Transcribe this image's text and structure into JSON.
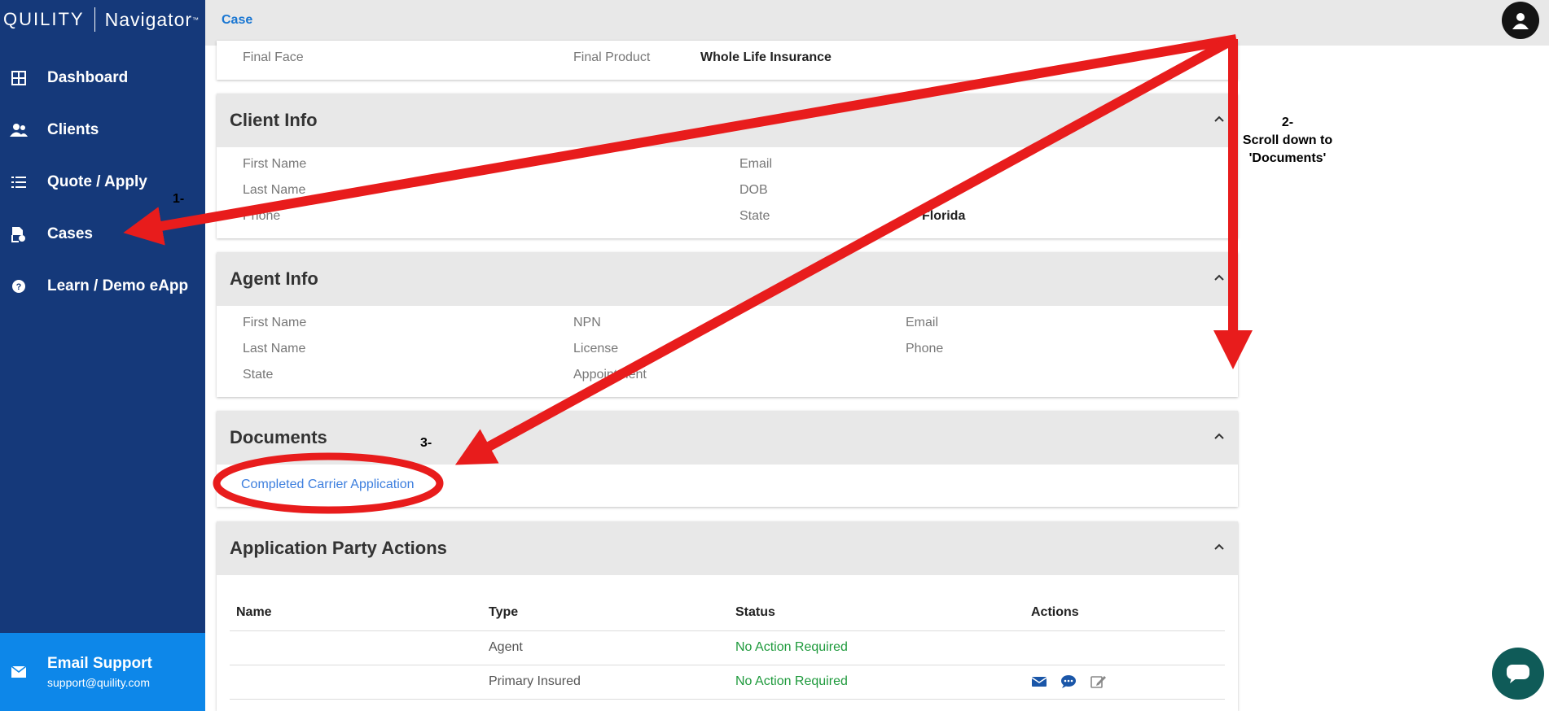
{
  "brand": {
    "name": "QUILITY",
    "product": "Navigator",
    "tm": "™"
  },
  "sidebar": {
    "items": [
      {
        "label": "Dashboard",
        "icon": "dashboard-icon"
      },
      {
        "label": "Clients",
        "icon": "clients-icon"
      },
      {
        "label": "Quote / Apply",
        "icon": "list-icon"
      },
      {
        "label": "Cases",
        "icon": "cases-icon"
      },
      {
        "label": "Learn / Demo eApp",
        "icon": "help-icon"
      }
    ],
    "support": {
      "title": "Email Support",
      "email": "support@quility.com"
    }
  },
  "topbar": {
    "breadcrumb": "Case"
  },
  "summary": {
    "final_face_label": "Final Face",
    "final_product_label": "Final Product",
    "final_product_value": "Whole Life Insurance"
  },
  "client_info": {
    "title": "Client Info",
    "first_name": "First Name",
    "last_name": "Last Name",
    "phone": "Phone",
    "email": "Email",
    "dob": "DOB",
    "state": "State",
    "state_value": "Florida"
  },
  "agent_info": {
    "title": "Agent Info",
    "first_name": "First Name",
    "last_name": "Last Name",
    "state": "State",
    "npn": "NPN",
    "license": "License",
    "appointment": "Appointment",
    "email": "Email",
    "phone": "Phone"
  },
  "documents": {
    "title": "Documents",
    "link": "Completed Carrier Application"
  },
  "party_actions": {
    "title": "Application Party Actions",
    "columns": [
      "Name",
      "Type",
      "Status",
      "Actions"
    ],
    "rows": [
      {
        "name": "",
        "type": "Agent",
        "status": "No Action Required"
      },
      {
        "name": "",
        "type": "Primary Insured",
        "status": "No Action Required"
      }
    ]
  },
  "annotations": {
    "step1": "1-",
    "step2_line1": "2-",
    "step2_line2": "Scroll down to",
    "step2_line3": "'Documents'",
    "step3": "3-"
  },
  "colors": {
    "sidebar": "#15397a",
    "support": "#0d87e9",
    "annotation": "#e81c1c",
    "link": "#3c7ede",
    "status_ok": "#1e9a3c"
  }
}
